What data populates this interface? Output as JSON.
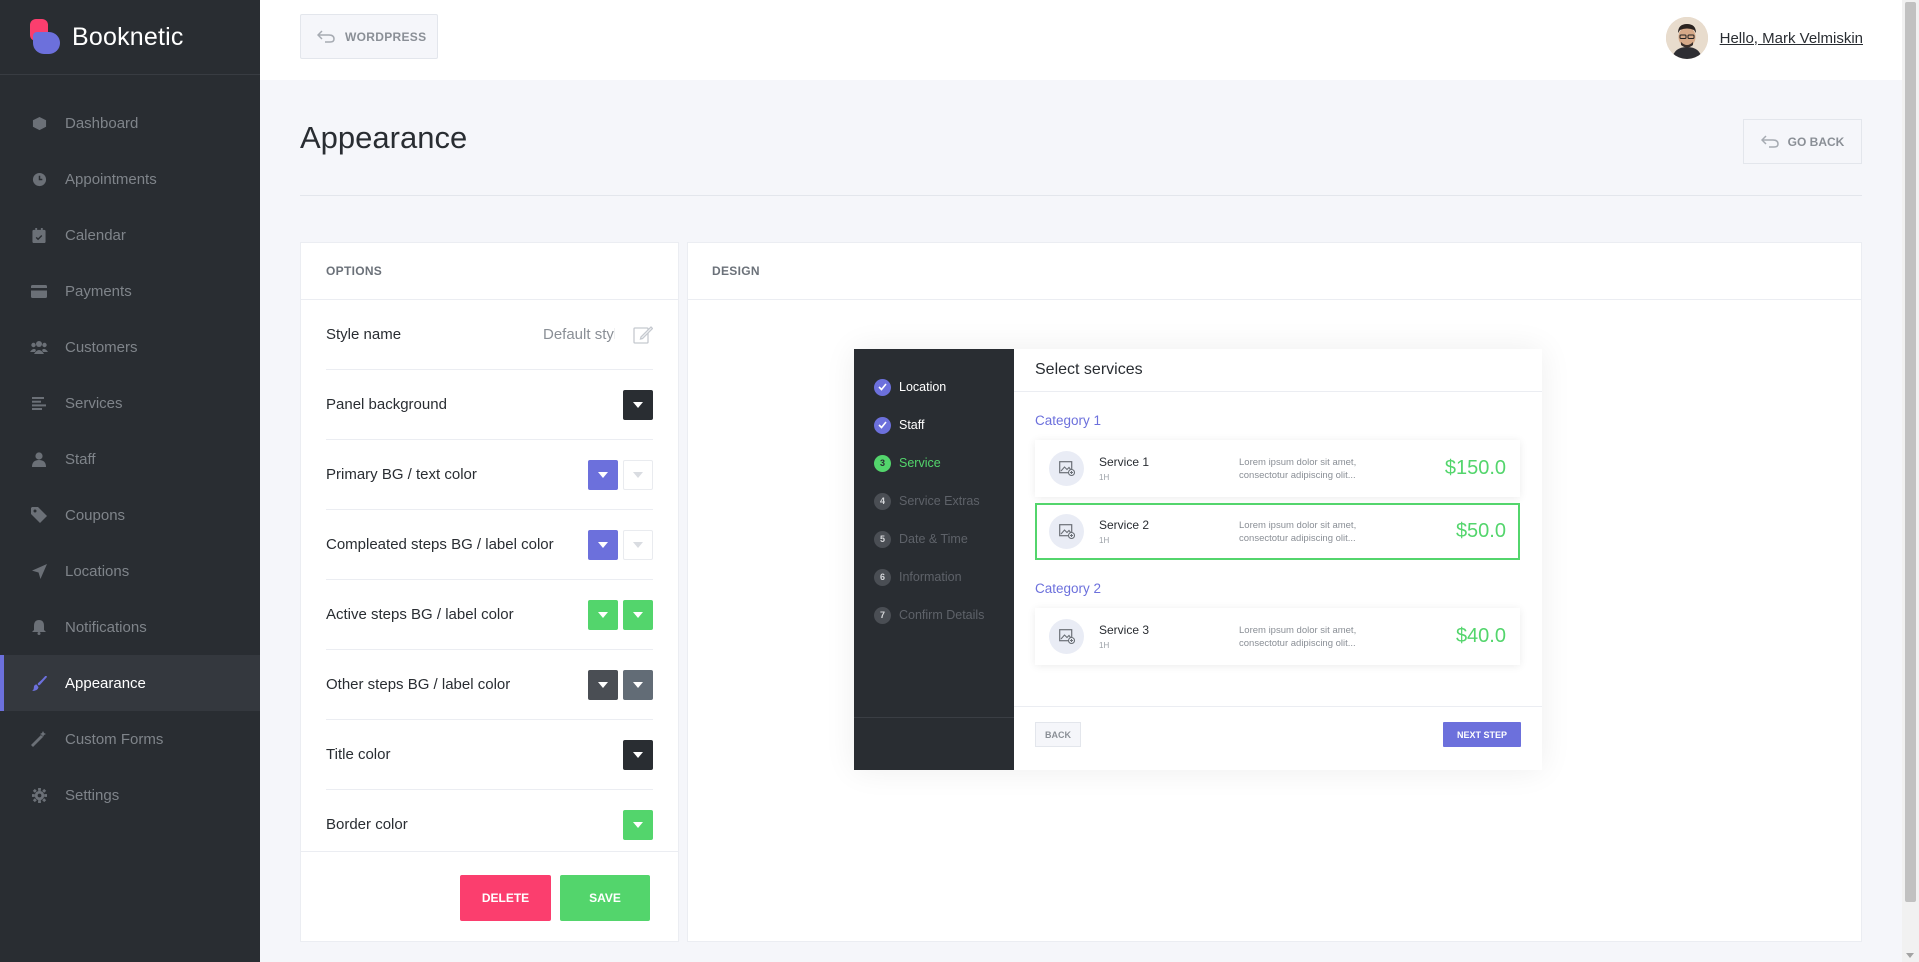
{
  "brand": {
    "name": "Booknetic"
  },
  "sidebar": {
    "items": [
      {
        "label": "Dashboard",
        "icon": "dashboard-icon"
      },
      {
        "label": "Appointments",
        "icon": "clock-icon"
      },
      {
        "label": "Calendar",
        "icon": "calendar-icon"
      },
      {
        "label": "Payments",
        "icon": "credit-card-icon"
      },
      {
        "label": "Customers",
        "icon": "users-icon"
      },
      {
        "label": "Services",
        "icon": "list-icon"
      },
      {
        "label": "Staff",
        "icon": "user-icon"
      },
      {
        "label": "Coupons",
        "icon": "tag-icon"
      },
      {
        "label": "Locations",
        "icon": "location-arrow-icon"
      },
      {
        "label": "Notifications",
        "icon": "bell-icon"
      },
      {
        "label": "Appearance",
        "icon": "brush-icon",
        "active": true
      },
      {
        "label": "Custom Forms",
        "icon": "magic-icon"
      },
      {
        "label": "Settings",
        "icon": "gear-icon"
      }
    ]
  },
  "topbar": {
    "wordpress_label": "WORDPRESS",
    "user_greeting": "Hello, Mark Velmiskin"
  },
  "page": {
    "title": "Appearance",
    "go_back_label": "GO BACK"
  },
  "options": {
    "header": "OPTIONS",
    "style_name_label": "Style name",
    "style_name_value": "Default style",
    "rows": [
      {
        "label": "Panel background",
        "colors": [
          "#292d32"
        ]
      },
      {
        "label": "Primary BG / text color",
        "colors": [
          "#6c70dc",
          "#ffffff"
        ]
      },
      {
        "label": "Compleated steps BG / label color",
        "colors": [
          "#6c70dc",
          "#ffffff"
        ]
      },
      {
        "label": "Active steps BG / label color",
        "colors": [
          "#53d56c",
          "#53d56c"
        ]
      },
      {
        "label": "Other steps BG / label color",
        "colors": [
          "#4a4e54",
          "#626c76"
        ]
      },
      {
        "label": "Title color",
        "colors": [
          "#292d32"
        ]
      },
      {
        "label": "Border color",
        "colors": [
          "#53d56c"
        ]
      }
    ],
    "delete_label": "DELETE",
    "save_label": "SAVE"
  },
  "design": {
    "header": "DESIGN",
    "steps": [
      {
        "num": "✓",
        "label": "Location",
        "state": "done"
      },
      {
        "num": "✓",
        "label": "Staff",
        "state": "done"
      },
      {
        "num": "3",
        "label": "Service",
        "state": "active"
      },
      {
        "num": "4",
        "label": "Service Extras",
        "state": "other"
      },
      {
        "num": "5",
        "label": "Date & Time",
        "state": "other"
      },
      {
        "num": "6",
        "label": "Information",
        "state": "other"
      },
      {
        "num": "7",
        "label": "Confirm Details",
        "state": "other"
      }
    ],
    "title": "Select services",
    "categories": [
      {
        "name": "Category 1",
        "services": [
          {
            "name": "Service 1",
            "duration": "1H",
            "desc_line1": "Lorem ipsum dolor sit amet,",
            "desc_line2": "consectotur adipiscing olit...",
            "price": "$150.0",
            "selected": false
          },
          {
            "name": "Service 2",
            "duration": "1H",
            "desc_line1": "Lorem ipsum dolor sit amet,",
            "desc_line2": "consectotur adipiscing olit...",
            "price": "$50.0",
            "selected": true
          }
        ]
      },
      {
        "name": "Category 2",
        "services": [
          {
            "name": "Service 3",
            "duration": "1H",
            "desc_line1": "Lorem ipsum dolor sit amet,",
            "desc_line2": "consectotur adipiscing olit...",
            "price": "$40.0",
            "selected": false
          }
        ]
      }
    ],
    "back_label": "BACK",
    "next_label": "NEXT STEP"
  }
}
